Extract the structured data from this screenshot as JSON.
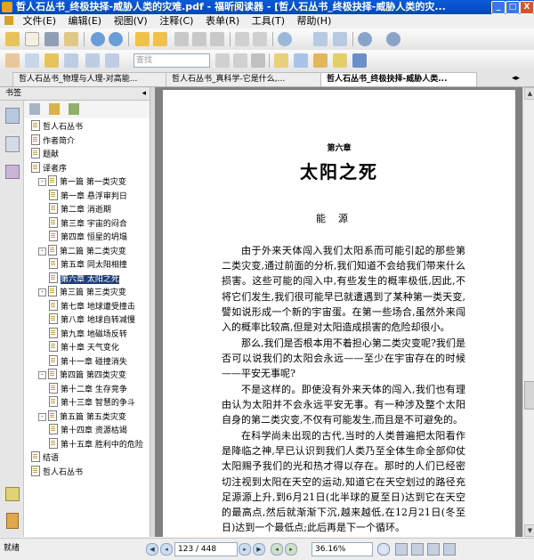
{
  "window": {
    "title": "哲人石丛书_终极抉择-威胁人类的灾难.pdf - 福昕阅读器 - [哲人石丛书_终极抉择-威胁人类的灾...",
    "minimize": "_",
    "maximize": "□",
    "close": "X"
  },
  "menu": {
    "items": [
      "文件(E)",
      "编辑(E)",
      "视图(V)",
      "注释(C)",
      "表单(R)",
      "工具(T)",
      "帮助(H)"
    ]
  },
  "toolbar": {
    "search_placeholder": "查找"
  },
  "tabs": [
    {
      "label": "哲人石丛书_物理与人理-对高能..."
    },
    {
      "label": "哲人石丛书_真科学-它是什么,..."
    },
    {
      "label": "哲人石丛书_终极抉择-威胁人类..."
    }
  ],
  "sidebar": {
    "header": "书签",
    "tree": [
      {
        "label": "哲人石丛书",
        "level": 1,
        "exp": ""
      },
      {
        "label": "作者简介",
        "level": 1,
        "exp": ""
      },
      {
        "label": "题献",
        "level": 1,
        "exp": ""
      },
      {
        "label": "译者序",
        "level": 1,
        "exp": ""
      },
      {
        "label": "第一篇 第一类灾变",
        "level": 0,
        "exp": "-"
      },
      {
        "label": "第一章 悬浮审判日",
        "level": 2,
        "exp": ""
      },
      {
        "label": "第二章 消逝期",
        "level": 2,
        "exp": ""
      },
      {
        "label": "第三章 宇宙的闷合",
        "level": 2,
        "exp": ""
      },
      {
        "label": "第四章 恒星的坍塌",
        "level": 2,
        "exp": ""
      },
      {
        "label": "第二篇 第二类灾变",
        "level": 0,
        "exp": "-"
      },
      {
        "label": "第五章 同太阳相撞",
        "level": 2,
        "exp": ""
      },
      {
        "label": "第六章 太阳之死",
        "level": 2,
        "exp": "",
        "selected": true
      },
      {
        "label": "第三篇 第三类灾变",
        "level": 0,
        "exp": "-"
      },
      {
        "label": "第七章 地球遭受撞击",
        "level": 2,
        "exp": ""
      },
      {
        "label": "第八章 地球自转减慢",
        "level": 2,
        "exp": ""
      },
      {
        "label": "第九章 地磁场反转",
        "level": 2,
        "exp": ""
      },
      {
        "label": "第十章 天气变化",
        "level": 2,
        "exp": ""
      },
      {
        "label": "第十一章 碰撞消失",
        "level": 2,
        "exp": ""
      },
      {
        "label": "第四篇 第四类灾变",
        "level": 0,
        "exp": "-"
      },
      {
        "label": "第十二章 生存竞争",
        "level": 2,
        "exp": ""
      },
      {
        "label": "第十三章 智慧的争斗",
        "level": 2,
        "exp": ""
      },
      {
        "label": "第五篇 第五类灾变",
        "level": 0,
        "exp": "-"
      },
      {
        "label": "第十四章 资源枯竭",
        "level": 2,
        "exp": ""
      },
      {
        "label": "第十五章 胜利中的危险",
        "level": 2,
        "exp": ""
      },
      {
        "label": "结语",
        "level": 1,
        "exp": ""
      },
      {
        "label": "哲人石丛书",
        "level": 1,
        "exp": ""
      }
    ]
  },
  "document": {
    "chapter_label": "第六章",
    "chapter_title": "太阳之死",
    "epigraph": "能    源",
    "paragraphs": [
      "由于外来天体闯入我们太阳系而可能引起的那些第二类灾变,通过前面的分析,我们知道不会给我们带来什么损害。这些可能的闯入中,有些发生的概率极低,因此,不将它们发生,我们很可能早已就遭遇到了某种第一类天变,譬如说形成一个新的宇宙蛋。在第一些场合,虽然外来闯入的概率比较高,但是对太阳造成损害的危险却很小。",
      "那么,我们是否根本用不着担心第二类灾变呢?我们是否可以说我们的太阳会永远——至少在宇宙存在的时候——平安无事呢?",
      "不是这样的。即使没有外来天体的闯入,我们也有理由认为太阳并不会永远平安无事。有一种涉及整个太阳自身的第二类灾变,不仅有可能发生,而且是不可避免的。",
      "在科学尚未出现的古代,当时的人类普遍把太阳看作是降临之神,早已认识到我们人类乃至全体生命全部仰仗太阳赐予我们的光和热才得以存在。那时的人们已经密切注视到太阳在天空的运动,知道它在天空划过的路径充足源源上升,到6月21日(北半球的夏至日)达到它在天空的最高点,然后就渐渐下沉,越来越低,在12月21日(冬至日)达到一个最低点;此后再是下一个循环。"
    ]
  },
  "statusbar": {
    "status": "就绪",
    "page": "123 / 448",
    "zoom": "36.16%"
  }
}
